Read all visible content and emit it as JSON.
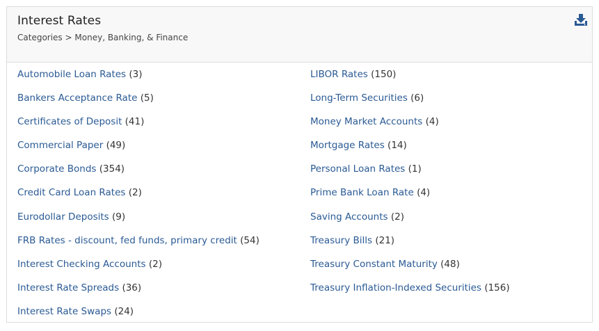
{
  "header": {
    "title": "Interest Rates",
    "breadcrumb_prefix": "Categories",
    "breadcrumb_separator": ">",
    "breadcrumb_current": "Money, Banking, & Finance",
    "download_icon": "download-icon",
    "accent_color": "#2a5a94"
  },
  "list": {
    "left": [
      {
        "label": "Automobile Loan Rates",
        "count": "(3)"
      },
      {
        "label": "Bankers Acceptance Rate",
        "count": "(5)"
      },
      {
        "label": "Certificates of Deposit",
        "count": "(41)"
      },
      {
        "label": "Commercial Paper",
        "count": "(49)"
      },
      {
        "label": "Corporate Bonds",
        "count": "(354)"
      },
      {
        "label": "Credit Card Loan Rates",
        "count": "(2)"
      },
      {
        "label": "Eurodollar Deposits",
        "count": "(9)"
      },
      {
        "label": "FRB Rates - discount, fed funds, primary credit",
        "count": "(54)"
      },
      {
        "label": "Interest Checking Accounts",
        "count": "(2)"
      },
      {
        "label": "Interest Rate Spreads",
        "count": "(36)"
      },
      {
        "label": "Interest Rate Swaps",
        "count": "(24)"
      }
    ],
    "right": [
      {
        "label": "LIBOR Rates",
        "count": "(150)"
      },
      {
        "label": "Long-Term Securities",
        "count": "(6)"
      },
      {
        "label": "Money Market Accounts",
        "count": "(4)"
      },
      {
        "label": "Mortgage Rates",
        "count": "(14)"
      },
      {
        "label": "Personal Loan Rates",
        "count": "(1)"
      },
      {
        "label": "Prime Bank Loan Rate",
        "count": "(4)"
      },
      {
        "label": "Saving Accounts",
        "count": "(2)"
      },
      {
        "label": "Treasury Bills",
        "count": "(21)"
      },
      {
        "label": "Treasury Constant Maturity",
        "count": "(48)"
      },
      {
        "label": "Treasury Inflation-Indexed Securities",
        "count": "(156)"
      }
    ]
  }
}
